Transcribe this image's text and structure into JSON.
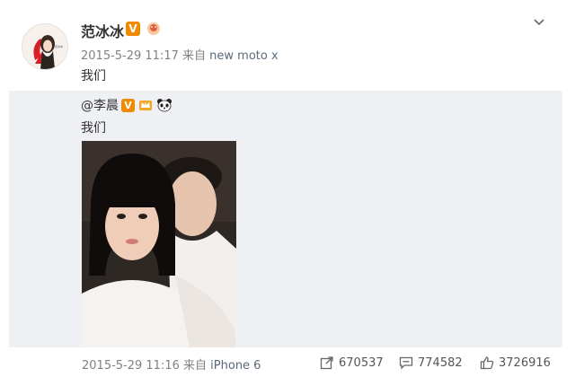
{
  "post": {
    "author": "范冰冰",
    "timestamp": "2015-5-29 11:17",
    "from_label": "来自",
    "source": "new moto x",
    "text": "我们"
  },
  "repost": {
    "mention": "@李晨",
    "text": "我们",
    "timestamp": "2015-5-29 11:16",
    "from_label": "来自",
    "source": "iPhone 6"
  },
  "actions": {
    "reposts": "670537",
    "comments": "774582",
    "likes": "3726916"
  },
  "icons": {
    "verified": "verified-v-badge",
    "menu": "chevron-down-icon",
    "repost": "share-icon",
    "comment": "comment-icon",
    "like": "thumbs-up-icon"
  },
  "colors": {
    "verified_badge": "#f08a00",
    "repost_background": "#eef0f4",
    "meta_text": "#808080"
  }
}
